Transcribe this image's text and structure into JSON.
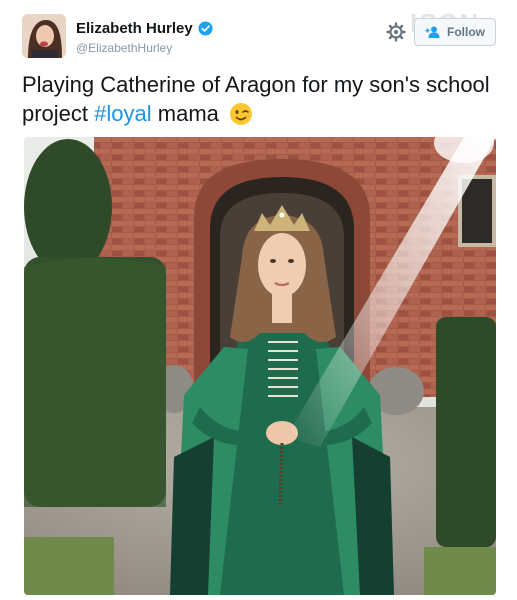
{
  "tweet": {
    "author": {
      "display_name": "Elizabeth Hurley",
      "handle": "@ElizabethHurley",
      "verified": true,
      "avatar_icon": "profile-photo"
    },
    "follow_label": "Follow",
    "text_before": "Playing Catherine of Aragon for my son's school project ",
    "hashtag": "#loyal",
    "text_after": " mama",
    "emoji": "winking-face",
    "photo_alt": "photo-attachment"
  },
  "watermark": "ICON",
  "colors": {
    "hashtag": "#1b95e0",
    "verified": "#1da1f2",
    "handle": "#8899a6"
  }
}
